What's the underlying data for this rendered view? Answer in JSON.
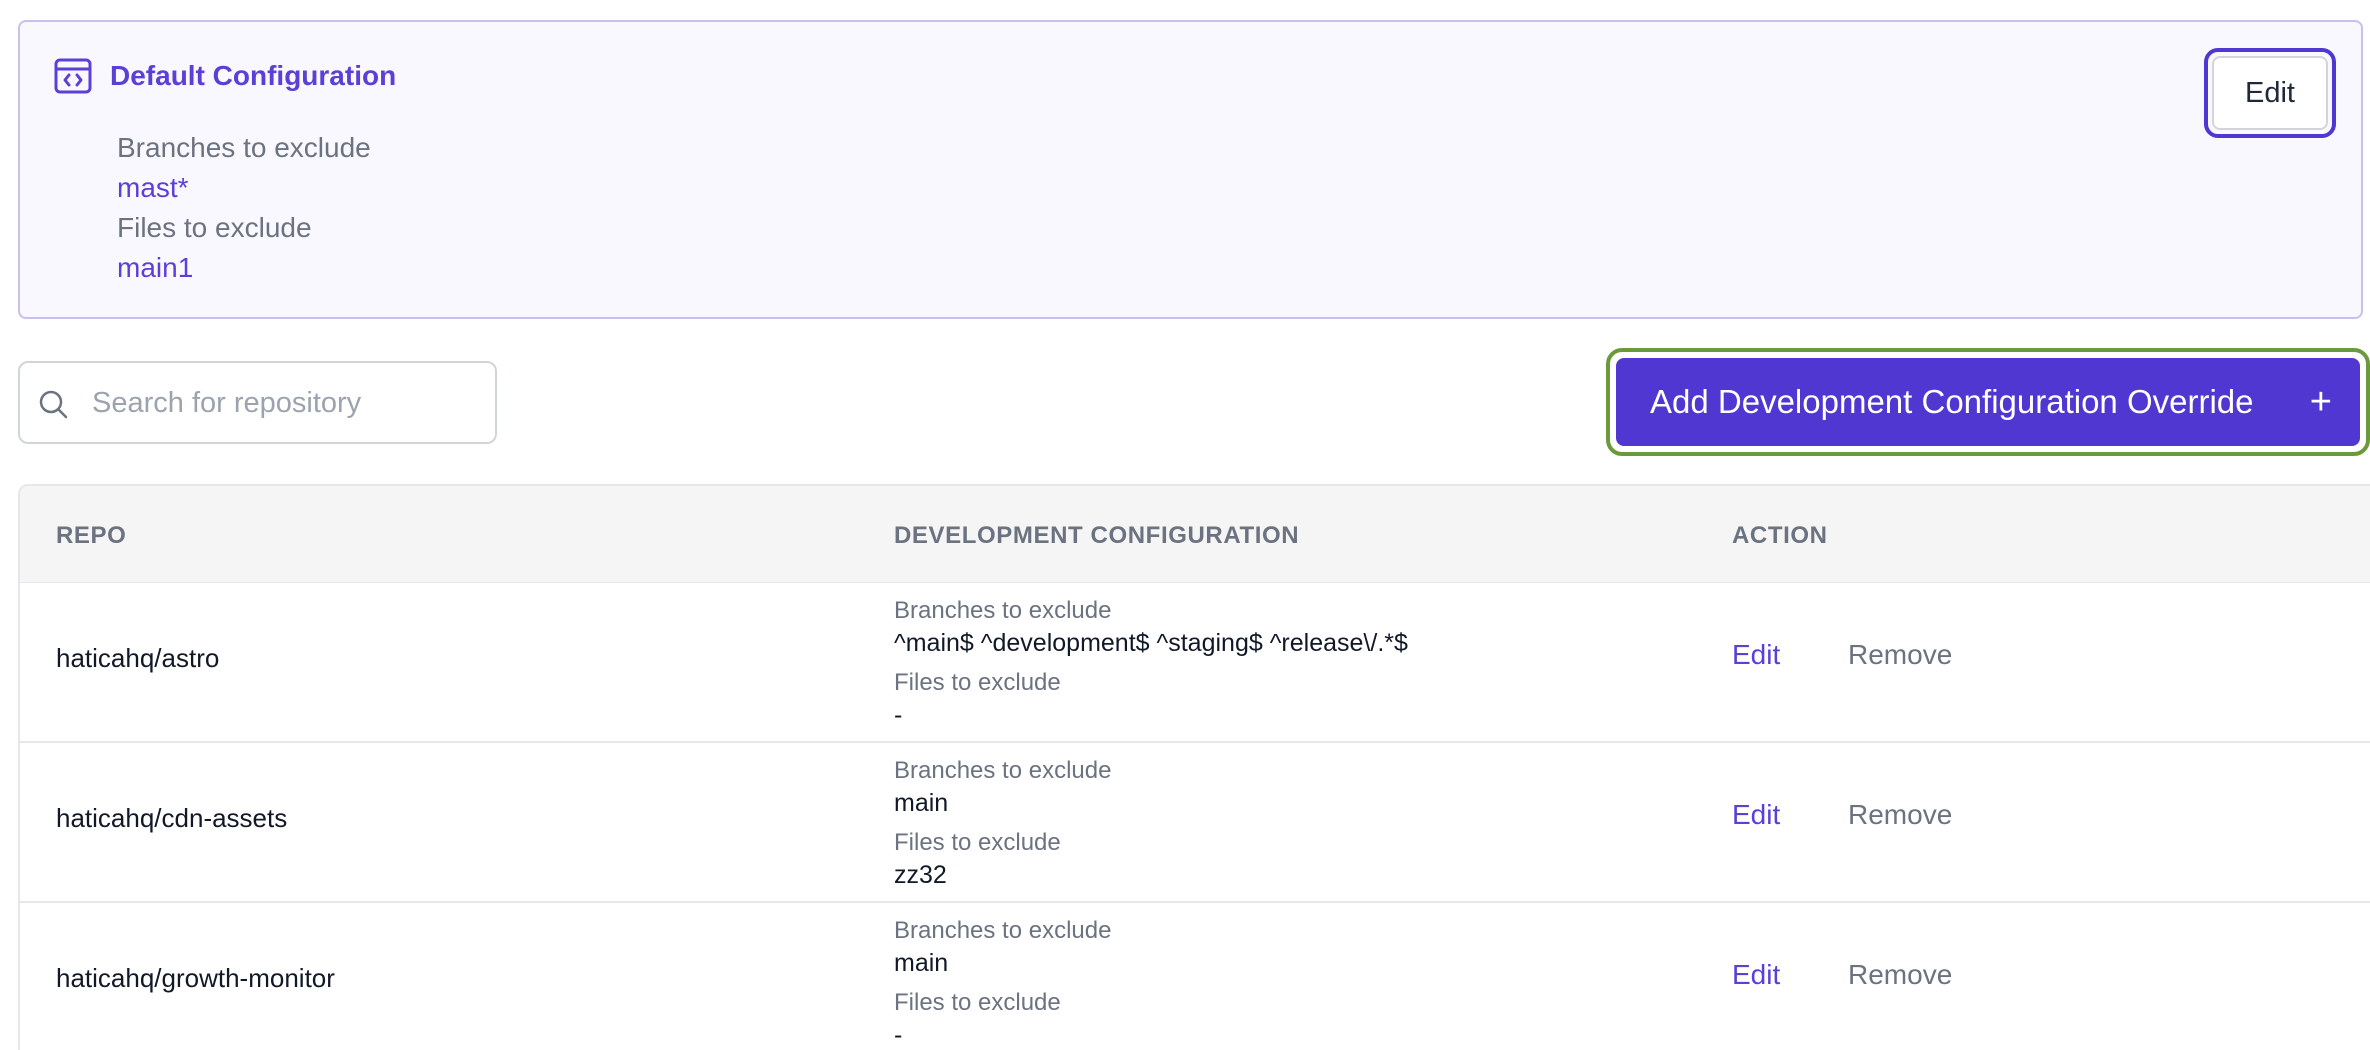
{
  "default_config": {
    "title": "Default Configuration",
    "icon": "code-window-icon",
    "branches_label": "Branches to exclude",
    "branches_value": "mast*",
    "files_label": "Files to exclude",
    "files_value": "main1",
    "edit_label": "Edit"
  },
  "search": {
    "placeholder": "Search for repository",
    "value": ""
  },
  "add_override": {
    "label": "Add Development Configuration Override",
    "icon": "plus-icon"
  },
  "table": {
    "headers": {
      "repo": "REPO",
      "config": "DEVELOPMENT CONFIGURATION",
      "action": "ACTION"
    },
    "rows": [
      {
        "repo": "haticahq/astro",
        "branches_label": "Branches to exclude",
        "branches": "^main$ ^development$ ^staging$ ^release\\/.*$",
        "files_label": "Files to exclude",
        "files": "-",
        "edit": "Edit",
        "remove": "Remove"
      },
      {
        "repo": "haticahq/cdn-assets",
        "branches_label": "Branches to exclude",
        "branches": "main",
        "files_label": "Files to exclude",
        "files": "zz32",
        "edit": "Edit",
        "remove": "Remove"
      },
      {
        "repo": "haticahq/growth-monitor",
        "branches_label": "Branches to exclude",
        "branches": "main",
        "files_label": "Files to exclude",
        "files": "-",
        "edit": "Edit",
        "remove": "Remove"
      }
    ]
  },
  "colors": {
    "accent": "#5137d1",
    "accent_text": "#5b40d6",
    "focus_green": "#6b9a3a",
    "muted_text": "#6b7280"
  }
}
